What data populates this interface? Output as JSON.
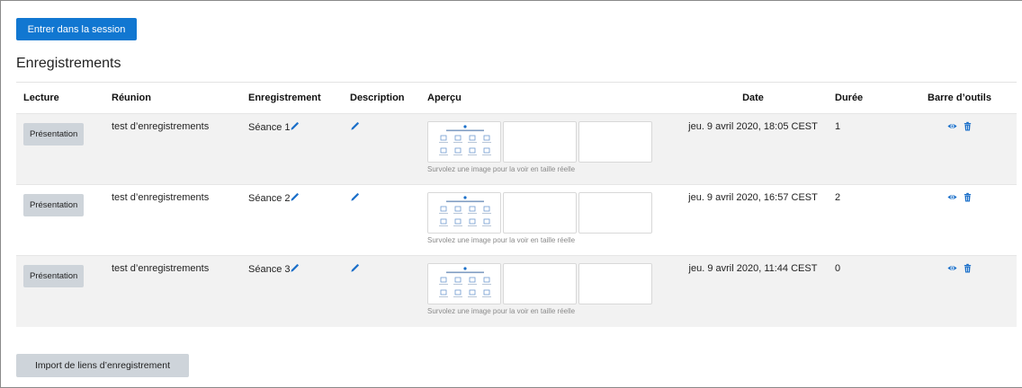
{
  "session": {
    "enter_label": "Entrer dans la session"
  },
  "recordings": {
    "title": "Enregistrements",
    "columns": {
      "lecture": "Lecture",
      "reunion": "Réunion",
      "enregistrement": "Enregistrement",
      "description": "Description",
      "apercu": "Aperçu",
      "date": "Date",
      "duree": "Durée",
      "barre": "Barre d’outils"
    },
    "rows": [
      {
        "play_label": "Présentation",
        "meeting": "test d’enregistrements",
        "recording": "Séance 1",
        "preview_hint": "Survolez une image pour la voir en taille réelle",
        "date": "jeu. 9 avril 2020, 18:05 CEST",
        "duration": "1"
      },
      {
        "play_label": "Présentation",
        "meeting": "test d’enregistrements",
        "recording": "Séance 2",
        "preview_hint": "Survolez une image pour la voir en taille réelle",
        "date": "jeu. 9 avril 2020, 16:57 CEST",
        "duration": "2"
      },
      {
        "play_label": "Présentation",
        "meeting": "test d’enregistrements",
        "recording": "Séance 3",
        "preview_hint": "Survolez une image pour la voir en taille réelle",
        "date": "jeu. 9 avril 2020, 11:44 CEST",
        "duration": "0"
      }
    ]
  },
  "import": {
    "label": "Import de liens d’enregistrement"
  },
  "icons": {
    "edit": "pencil-icon",
    "view": "eye-icon",
    "delete": "trash-icon"
  },
  "colors": {
    "primary": "#1177d1",
    "secondary_button": "#ced4da",
    "row_stripe": "#f2f2f2"
  }
}
